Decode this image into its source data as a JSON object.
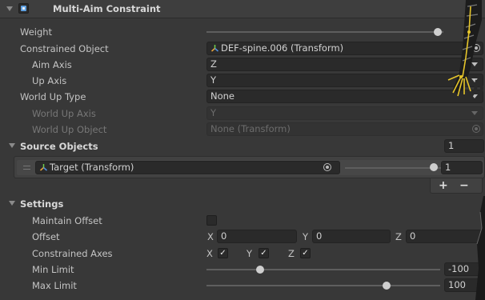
{
  "header": {
    "title": "Multi-Aim Constraint"
  },
  "fields": {
    "weight": {
      "label": "Weight"
    },
    "constrained_object": {
      "label": "Constrained Object",
      "value": "DEF-spine.006 (Transform)"
    },
    "aim_axis": {
      "label": "Aim Axis",
      "value": "Z"
    },
    "up_axis": {
      "label": "Up Axis",
      "value": "Y"
    },
    "world_up_type": {
      "label": "World Up Type",
      "value": "None"
    },
    "world_up_axis": {
      "label": "World Up Axis",
      "value": "Y"
    },
    "world_up_object": {
      "label": "World Up Object",
      "value": "None (Transform)"
    }
  },
  "source_objects": {
    "label": "Source Objects",
    "count": "1",
    "items": [
      {
        "name": "Target (Transform)",
        "weight": "1",
        "weight_fraction": 1.0
      }
    ],
    "add_label": "+",
    "remove_label": "−"
  },
  "settings": {
    "label": "Settings",
    "maintain_offset": {
      "label": "Maintain Offset",
      "checked": false
    },
    "offset": {
      "label": "Offset",
      "x_label": "X",
      "x": "0",
      "y_label": "Y",
      "y": "0",
      "z_label": "Z",
      "z": "0"
    },
    "constrained_axes": {
      "label": "Constrained Axes",
      "x_label": "X",
      "y_label": "Y",
      "z_label": "Z",
      "check": "✓"
    },
    "min_limit": {
      "label": "Min Limit",
      "value": "-100"
    },
    "max_limit": {
      "label": "Max Limit",
      "value": "100"
    }
  },
  "colors": {
    "background": "#383838",
    "header": "#3e3e3e",
    "field": "#2a2a2a",
    "source_row": "#454545"
  }
}
